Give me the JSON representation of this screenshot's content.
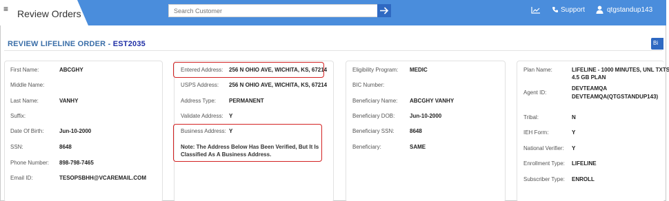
{
  "header": {
    "menu_glyph": "≡",
    "app_title": "Review Orders",
    "search_placeholder": "Search Customer",
    "support_label": "Support",
    "username": "qtgstandup143"
  },
  "page": {
    "title_prefix": "REVIEW LIFELINE ORDER - ",
    "order_code": "EST2035",
    "edge_button_label": "Bi"
  },
  "personal": [
    {
      "label": "First Name:",
      "value": "ABCGHY"
    },
    {
      "label": "Middle Name:",
      "value": ""
    },
    {
      "label": "Last Name:",
      "value": "VANHY"
    },
    {
      "label": "Suffix:",
      "value": ""
    },
    {
      "label": "Date Of Birth:",
      "value": "Jun-10-2000"
    },
    {
      "label": "SSN:",
      "value": "8648"
    },
    {
      "label": "Phone Number:",
      "value": "898-798-7465"
    },
    {
      "label": "Email ID:",
      "value": "TESOPSBHH@VCAREMAIL.COM"
    }
  ],
  "address": [
    {
      "label": "Entered Address:",
      "value": "256 N OHIO AVE, WICHITA, KS, 67214"
    },
    {
      "label": "USPS Address:",
      "value": "256 N OHIO AVE, WICHITA, KS, 67214"
    },
    {
      "label": "Address Type:",
      "value": "PERMANENT"
    },
    {
      "label": "Validate Address:",
      "value": "Y"
    },
    {
      "label": "Business Address:",
      "value": "Y"
    }
  ],
  "address_note_line1": "Note: The Address Below Has Been Verified, But It Is",
  "address_note_line2": "Classified As A Business Address.",
  "eligibility": [
    {
      "label": "Eligibility Program:",
      "value": "MEDIC"
    },
    {
      "label": "BIC Number:",
      "value": ""
    },
    {
      "label": "Beneficiary Name:",
      "value": "ABCGHY VANHY"
    },
    {
      "label": "Beneficiary DOB:",
      "value": "Jun-10-2000"
    },
    {
      "label": "Beneficiary SSN:",
      "value": "8648"
    },
    {
      "label": "Beneficiary:",
      "value": "SAME"
    }
  ],
  "plan": {
    "plan_label": "Plan Name:",
    "plan_line1": "LIFELINE - 1000 MINUTES, UNL TXTS -",
    "plan_line2": "4.5 GB PLAN",
    "agent_label": "Agent ID:",
    "agent_line1": "DEVTEAMQA",
    "agent_line2": "DEVTEAMQA(QTGSTANDUP143)",
    "rows": [
      {
        "label": "Tribal:",
        "value": "N"
      },
      {
        "label": "IEH Form:",
        "value": "Y"
      },
      {
        "label": "National Verifier:",
        "value": "Y"
      },
      {
        "label": "Enrollment Type:",
        "value": "LIFELINE"
      },
      {
        "label": "Subscriber Type:",
        "value": "ENROLL"
      }
    ]
  },
  "colors": {
    "topbar": "#4a8ddc",
    "title_blue": "#3a6ea8",
    "code_blue": "#1f2fa6",
    "highlight_red": "#d32121"
  }
}
